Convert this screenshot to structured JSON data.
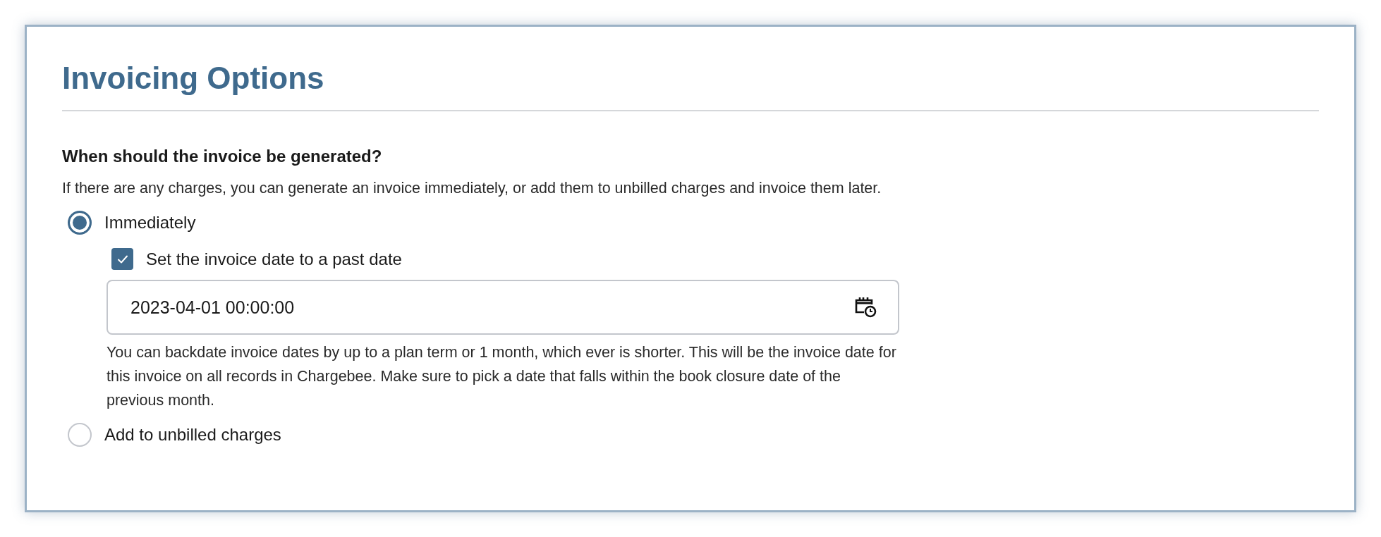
{
  "panel": {
    "title": "Invoicing Options"
  },
  "question": {
    "label": "When should the invoice be generated?",
    "description": "If there are any charges, you can generate an invoice immediately, or add them to unbilled charges and invoice them later."
  },
  "options": [
    {
      "label": "Immediately",
      "selected": true,
      "checkbox": {
        "label": "Set the invoice date to a past date",
        "checked": true
      },
      "date_field": {
        "value": "2023-04-01 00:00:00",
        "help": "You can backdate invoice dates by up to a plan term or 1 month, which ever is shorter. This will be the invoice date for this invoice on all records in Chargebee. Make sure to pick a date that falls within the book closure date of the previous month."
      }
    },
    {
      "label": "Add to unbilled charges",
      "selected": false
    }
  ]
}
